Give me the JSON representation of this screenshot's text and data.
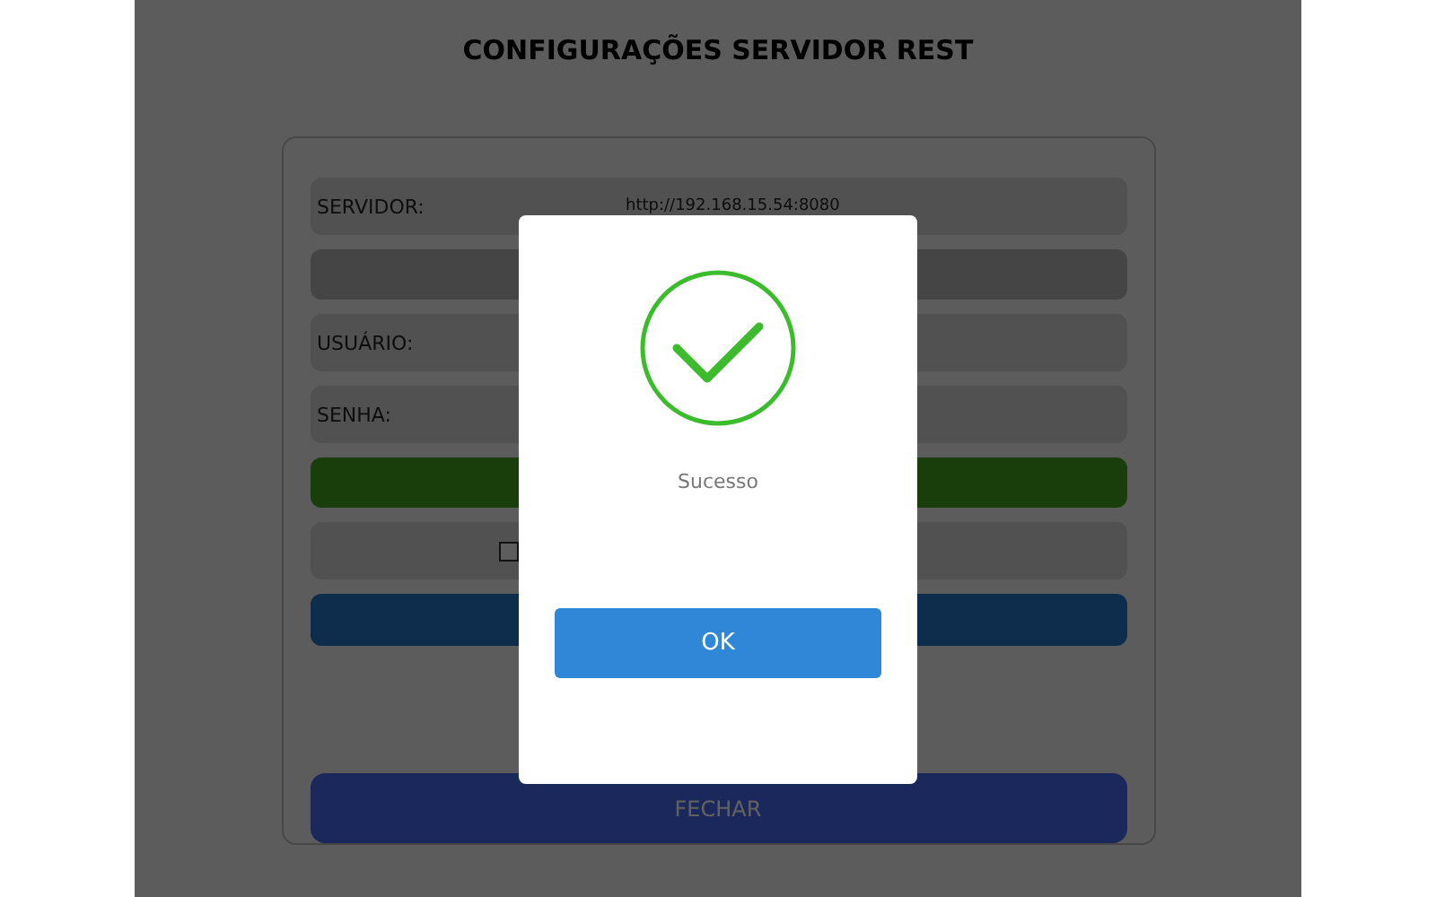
{
  "page": {
    "title": "CONFIGURAÇÕES SERVIDOR REST"
  },
  "fields": [
    {
      "label": "SERVIDOR:",
      "value": "http://192.168.15.54:8080"
    },
    {
      "kind": "bar"
    },
    {
      "label": "USUÁRIO:"
    },
    {
      "label": "SENHA:"
    },
    {
      "kind": "green"
    },
    {
      "kind": "checkbox",
      "checked": false
    },
    {
      "kind": "blue"
    },
    {
      "kind": "spacer"
    },
    {
      "kind": "close",
      "label": "FECHAR"
    }
  ],
  "dialog": {
    "message": "Sucesso",
    "button": "OK"
  }
}
